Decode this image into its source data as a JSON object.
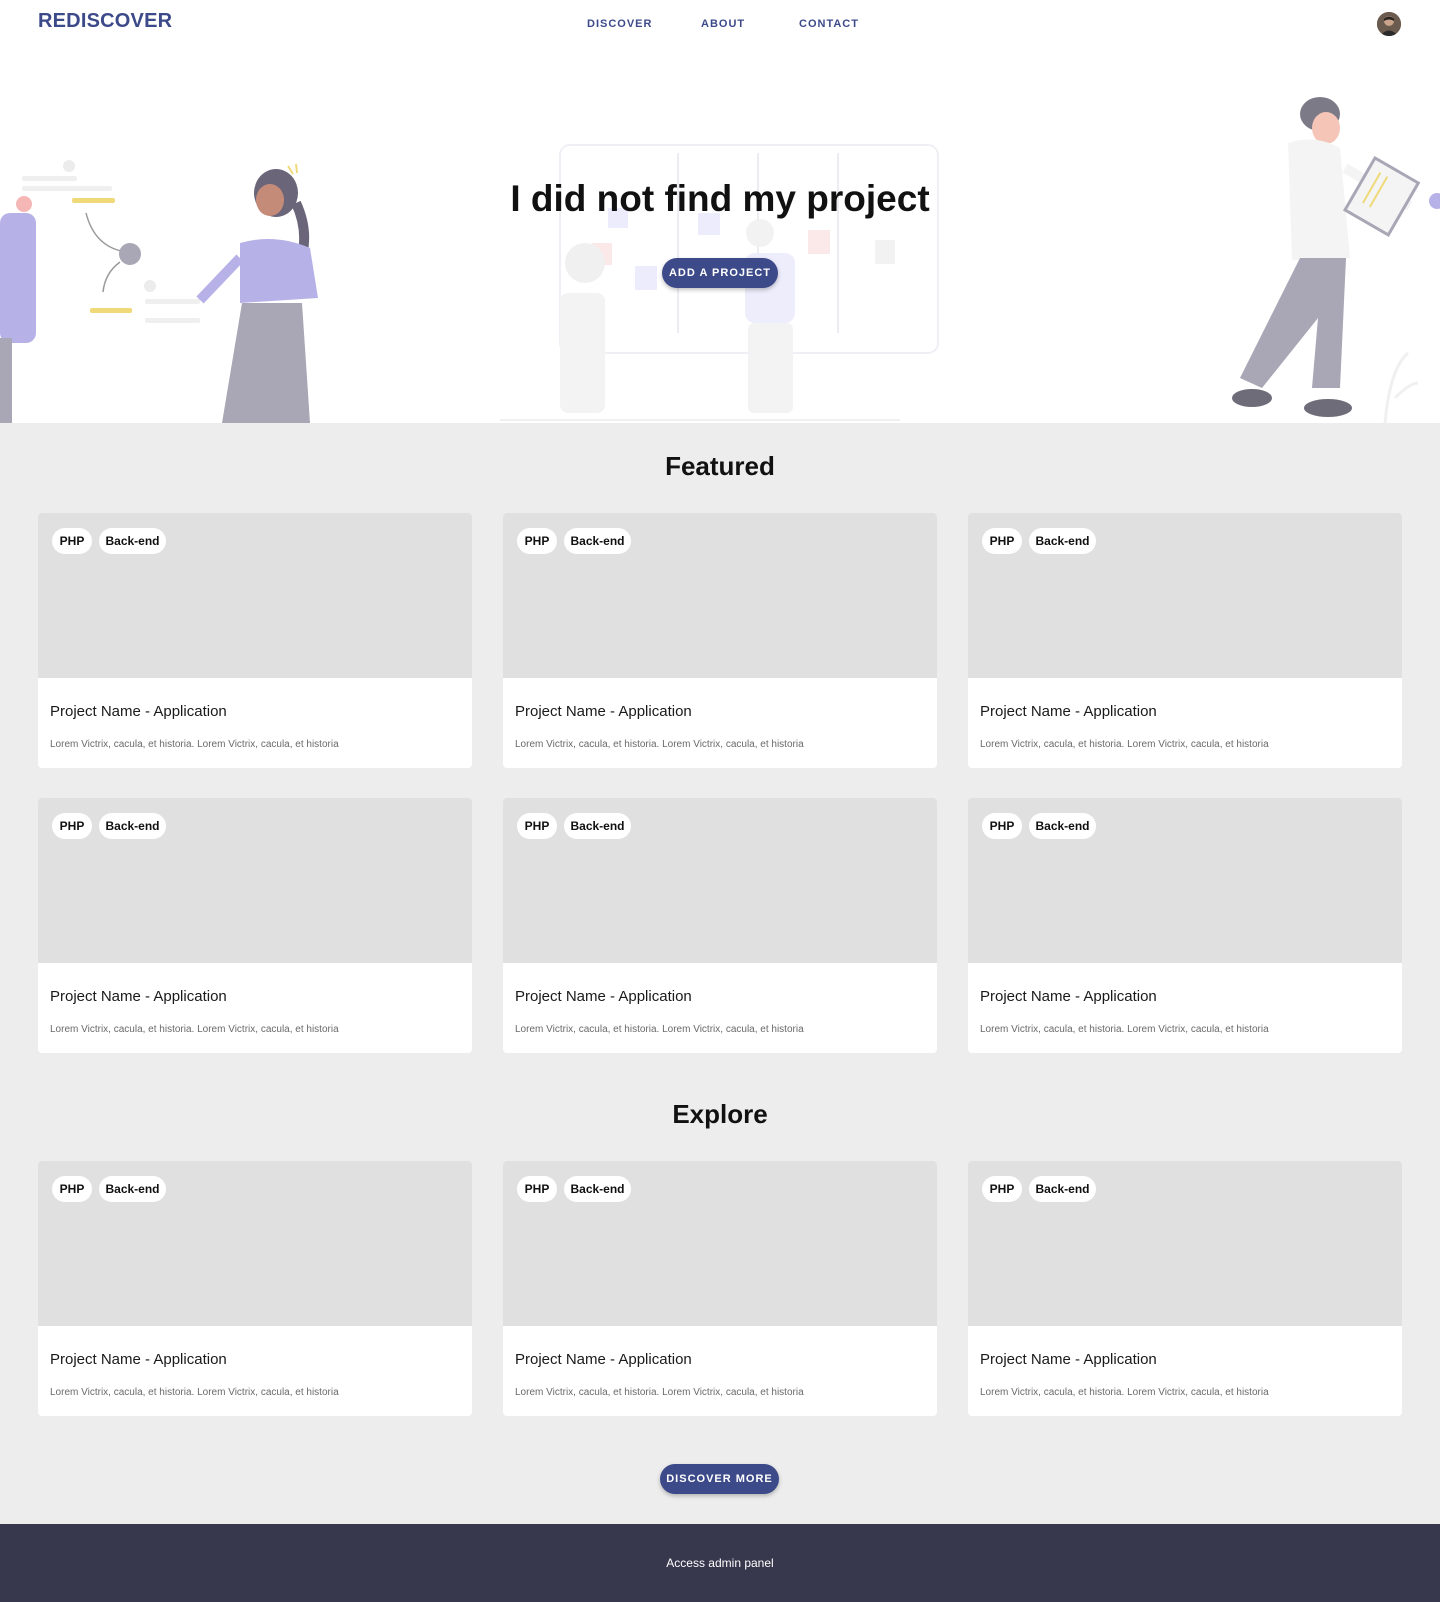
{
  "header": {
    "logo": "REDISCOVER",
    "nav": [
      "DISCOVER",
      "ABOUT",
      "CONTACT"
    ]
  },
  "hero": {
    "title": "I did not find my project",
    "button": "ADD A PROJECT"
  },
  "featured": {
    "title": "Featured",
    "cards": [
      {
        "tags": [
          "PHP",
          "Back-end"
        ],
        "name": "Project Name - Application",
        "desc": "Lorem Victrix, cacula, et historia. Lorem Victrix, cacula, et historia"
      },
      {
        "tags": [
          "PHP",
          "Back-end"
        ],
        "name": "Project Name - Application",
        "desc": "Lorem Victrix, cacula, et historia. Lorem Victrix, cacula, et historia"
      },
      {
        "tags": [
          "PHP",
          "Back-end"
        ],
        "name": "Project Name - Application",
        "desc": "Lorem Victrix, cacula, et historia. Lorem Victrix, cacula, et historia"
      },
      {
        "tags": [
          "PHP",
          "Back-end"
        ],
        "name": "Project Name - Application",
        "desc": "Lorem Victrix, cacula, et historia. Lorem Victrix, cacula, et historia"
      },
      {
        "tags": [
          "PHP",
          "Back-end"
        ],
        "name": "Project Name - Application",
        "desc": "Lorem Victrix, cacula, et historia. Lorem Victrix, cacula, et historia"
      },
      {
        "tags": [
          "PHP",
          "Back-end"
        ],
        "name": "Project Name - Application",
        "desc": "Lorem Victrix, cacula, et historia. Lorem Victrix, cacula, et historia"
      }
    ]
  },
  "explore": {
    "title": "Explore",
    "cards": [
      {
        "tags": [
          "PHP",
          "Back-end"
        ],
        "name": "Project Name - Application",
        "desc": "Lorem Victrix, cacula, et historia. Lorem Victrix, cacula, et historia"
      },
      {
        "tags": [
          "PHP",
          "Back-end"
        ],
        "name": "Project Name - Application",
        "desc": "Lorem Victrix, cacula, et historia. Lorem Victrix, cacula, et historia"
      },
      {
        "tags": [
          "PHP",
          "Back-end"
        ],
        "name": "Project Name - Application",
        "desc": "Lorem Victrix, cacula, et historia. Lorem Victrix, cacula, et historia"
      }
    ],
    "button": "DISCOVER MORE"
  },
  "footer": {
    "link": "Access admin panel"
  },
  "colors": {
    "brand": "#3d4a8a",
    "footer": "#37374e",
    "background": "#ededed",
    "thumb": "#e0e0e0"
  }
}
